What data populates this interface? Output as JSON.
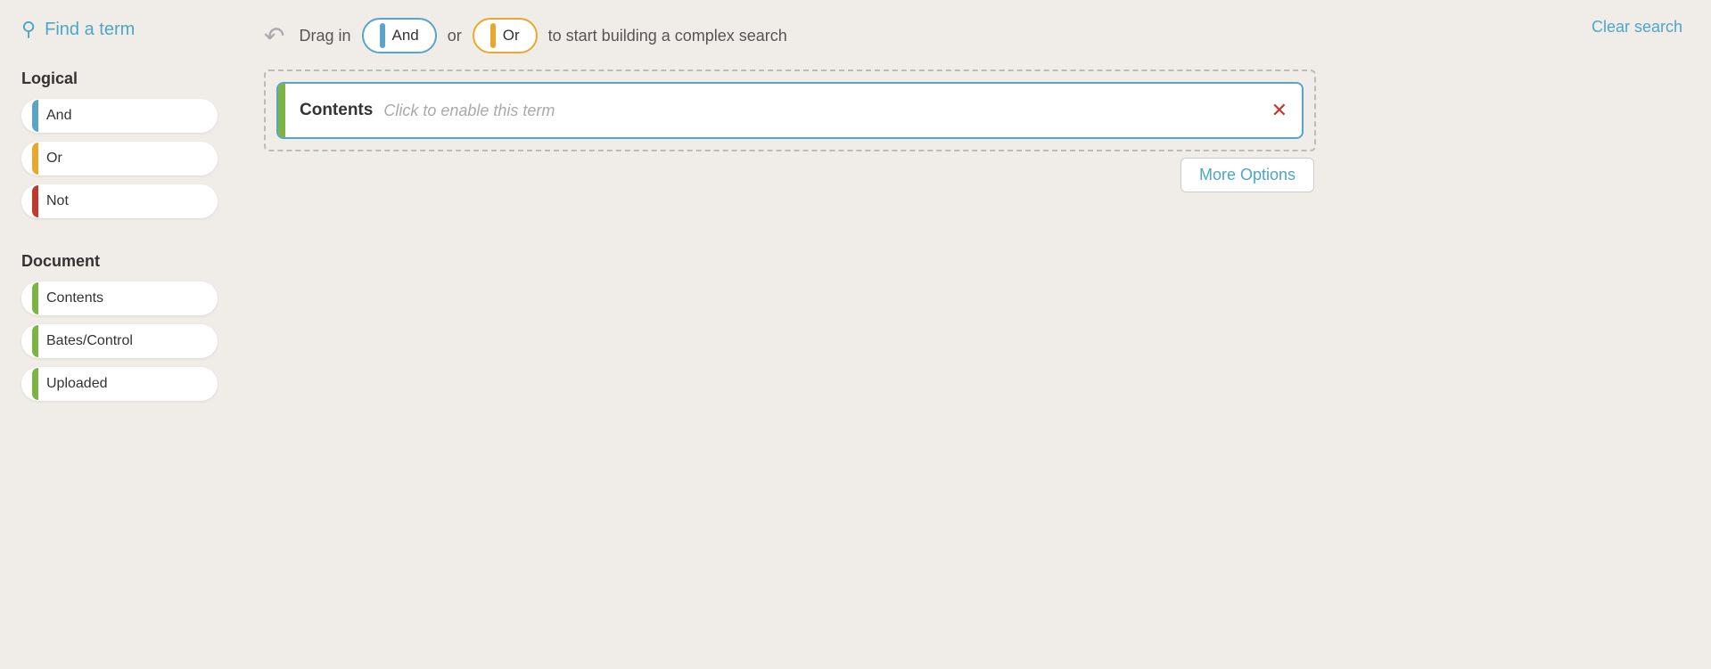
{
  "sidebar": {
    "find_term_label": "Find a term",
    "logical_heading": "Logical",
    "document_heading": "Document",
    "logical_terms": [
      {
        "id": "and",
        "label": "And",
        "color": "blue"
      },
      {
        "id": "or",
        "label": "Or",
        "color": "orange"
      },
      {
        "id": "not",
        "label": "Not",
        "color": "red"
      }
    ],
    "document_terms": [
      {
        "id": "contents",
        "label": "Contents",
        "color": "green"
      },
      {
        "id": "bates",
        "label": "Bates/Control",
        "color": "green"
      },
      {
        "id": "uploaded",
        "label": "Uploaded",
        "color": "green"
      }
    ]
  },
  "header": {
    "drag_text_pre": "Drag in",
    "drag_and": "And",
    "drag_or_connector": "or",
    "drag_or": "Or",
    "drag_text_post": "to start building a complex search",
    "clear_search": "Clear search"
  },
  "search_area": {
    "term_label": "Contents",
    "term_hint": "Click to enable this term",
    "more_options": "More Options"
  }
}
